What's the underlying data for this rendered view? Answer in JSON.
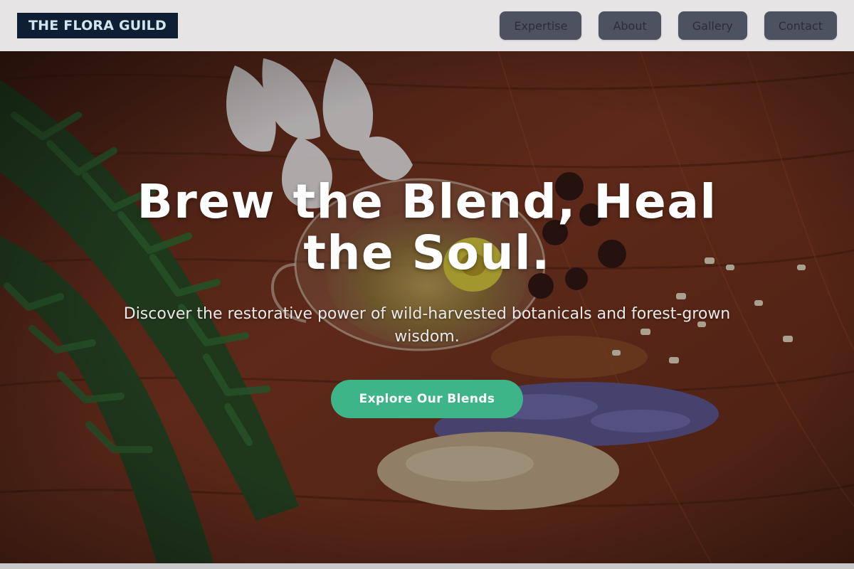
{
  "brand": {
    "name": "THE FLORA GUILD"
  },
  "nav": {
    "items": [
      {
        "label": "Expertise"
      },
      {
        "label": "About"
      },
      {
        "label": "Gallery"
      },
      {
        "label": "Contact"
      }
    ]
  },
  "hero": {
    "title": "Brew the Blend, Heal the Soul.",
    "subtitle": "Discover the restorative power of wild-harvested botanicals and forest-grown wisdom.",
    "cta_label": "Explore Our Blends",
    "image_icon": "herbal-tea-photo"
  },
  "colors": {
    "header_bg": "#e6e4e5",
    "logo_bg": "#0f1f33",
    "logo_text": "#cfe6ec",
    "nav_button_bg": "#4d5261",
    "cta_bg": "#3eb489",
    "hero_wood": "#5a2a18"
  }
}
